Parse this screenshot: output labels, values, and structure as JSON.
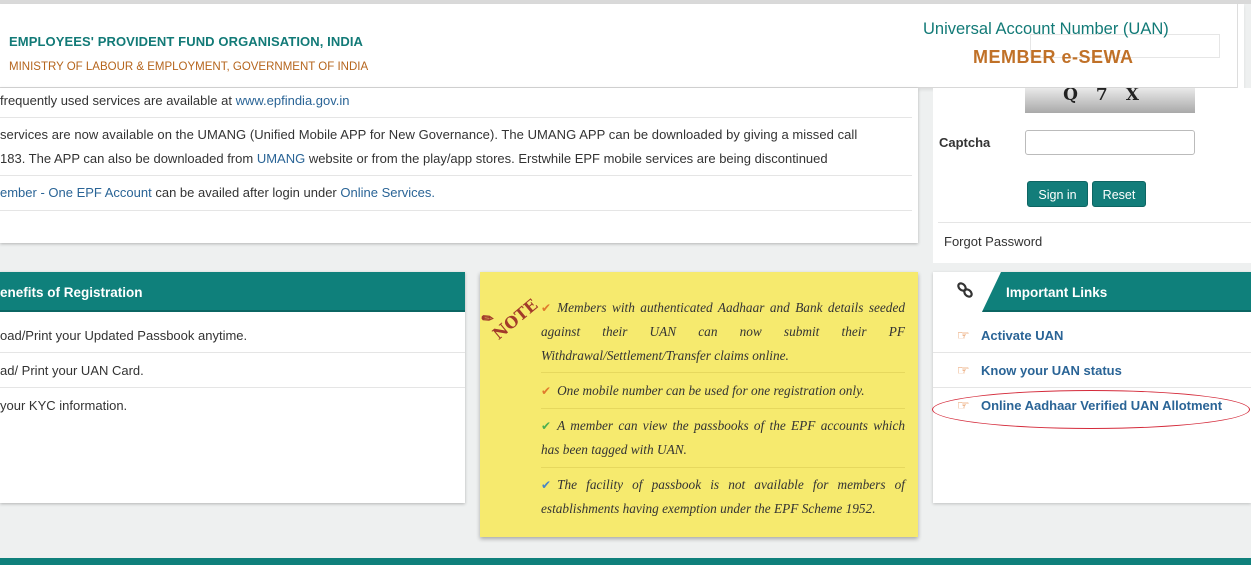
{
  "header": {
    "org_name": "EMPLOYEES' PROVIDENT FUND ORGANISATION, INDIA",
    "ministry": "MINISTRY OF LABOUR & EMPLOYMENT, GOVERNMENT OF INDIA",
    "uan_title": "Universal Account Number (UAN)",
    "member_esewa": "MEMBER e-SEWA"
  },
  "info": {
    "row1_prefix": "frequently used services are available at ",
    "row1_link": "www.epfindia.gov.in",
    "row2_line1": "services are now available on the UMANG (Unified Mobile APP for New Governance). The UMANG APP can be downloaded by giving a missed call",
    "row2_line2_prefix": "183. The APP can also be downloaded from ",
    "row2_link": "UMANG",
    "row2_line2_suffix": " website or from the play/app stores. Erstwhile EPF mobile services are being discontinued",
    "row3_link1": "ember - One EPF Account",
    "row3_middle": " can be availed after login under ",
    "row3_link2": "Online Services."
  },
  "login": {
    "captcha_text": "Q7X",
    "captcha_label": "Captcha",
    "captcha_value": "",
    "signin_label": "Sign in",
    "reset_label": "Reset",
    "forgot_label": "Forgot Password"
  },
  "benefits": {
    "title": "enefits of Registration",
    "items": [
      "oad/Print your Updated Passbook anytime.",
      "ad/ Print your UAN Card.",
      " your KYC information."
    ]
  },
  "note": {
    "badge": "NOTE",
    "items": [
      {
        "text": "Members with authenticated Aadhaar and Bank details seeded against their UAN can now submit their PF Withdrawal/Settlement/Transfer claims online.",
        "color": "#e07a2c"
      },
      {
        "text": "One mobile number can be used for one registration only.",
        "color": "#e07a2c"
      },
      {
        "text": "A member can view the passbooks of the EPF accounts which has been tagged with UAN.",
        "color": "#4caf50"
      },
      {
        "text": "The facility of passbook is not available for members of establishments having exemption under the EPF Scheme 1952.",
        "color": "#4a86c5"
      }
    ]
  },
  "important_links": {
    "title": "Important Links",
    "items": [
      "Activate UAN",
      "Know your UAN status",
      "Online Aadhaar Verified UAN Allotment"
    ]
  },
  "colors": {
    "teal": "#0f807b",
    "note_yellow": "#f6ea6e",
    "highlight_red": "#d42a3a"
  }
}
